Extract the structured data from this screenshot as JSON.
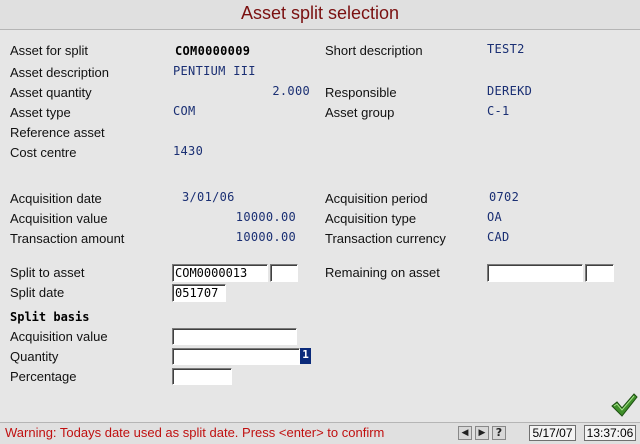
{
  "window": {
    "title": "Asset split selection"
  },
  "details": {
    "asset_for_split": {
      "label": "Asset for split",
      "value": "COM0000009"
    },
    "short_description": {
      "label": "Short description",
      "value": "TEST2"
    },
    "asset_description": {
      "label": "Asset description",
      "value": "PENTIUM III"
    },
    "asset_quantity": {
      "label": "Asset quantity",
      "value": "2.000"
    },
    "responsible": {
      "label": "Responsible",
      "value": "DEREKD"
    },
    "asset_type": {
      "label": "Asset type",
      "value": "COM"
    },
    "asset_group": {
      "label": "Asset group",
      "value": "C-1"
    },
    "reference_asset": {
      "label": "Reference asset",
      "value": ""
    },
    "cost_centre": {
      "label": "Cost centre",
      "value": "1430"
    }
  },
  "acquisition": {
    "date": {
      "label": "Acquisition date",
      "value": "3/01/06"
    },
    "period": {
      "label": "Acquisition period",
      "value": "0702"
    },
    "value": {
      "label": "Acquisition value",
      "value": "10000.00"
    },
    "type": {
      "label": "Acquisition type",
      "value": "OA"
    },
    "transaction_amount": {
      "label": "Transaction amount",
      "value": "10000.00"
    },
    "transaction_currency": {
      "label": "Transaction currency",
      "value": "CAD"
    }
  },
  "split": {
    "split_to_asset": {
      "label": "Split to asset",
      "value": "COM0000013",
      "suffix": ""
    },
    "remaining_on_asset": {
      "label": "Remaining on asset",
      "value": "",
      "suffix": ""
    },
    "split_date": {
      "label": "Split date",
      "value": "051707"
    },
    "basis_heading": "Split basis",
    "acquisition_value": {
      "label": "Acquisition value",
      "value": ""
    },
    "quantity": {
      "label": "Quantity",
      "value": "",
      "cursor": "1"
    },
    "percentage": {
      "label": "Percentage",
      "value": ""
    }
  },
  "status": {
    "message": "Warning: Todays date used as split date. Press <enter> to confirm",
    "date": "5/17/07",
    "time": "13:37:06",
    "nav_prev": "◀",
    "nav_next": "▶",
    "nav_help": "?"
  },
  "colors": {
    "title": "#7a1010",
    "value": "#1a2f73",
    "warning": "#c01010",
    "check": "#3f8f2a"
  },
  "icons": {
    "confirm": "checkmark-icon"
  }
}
